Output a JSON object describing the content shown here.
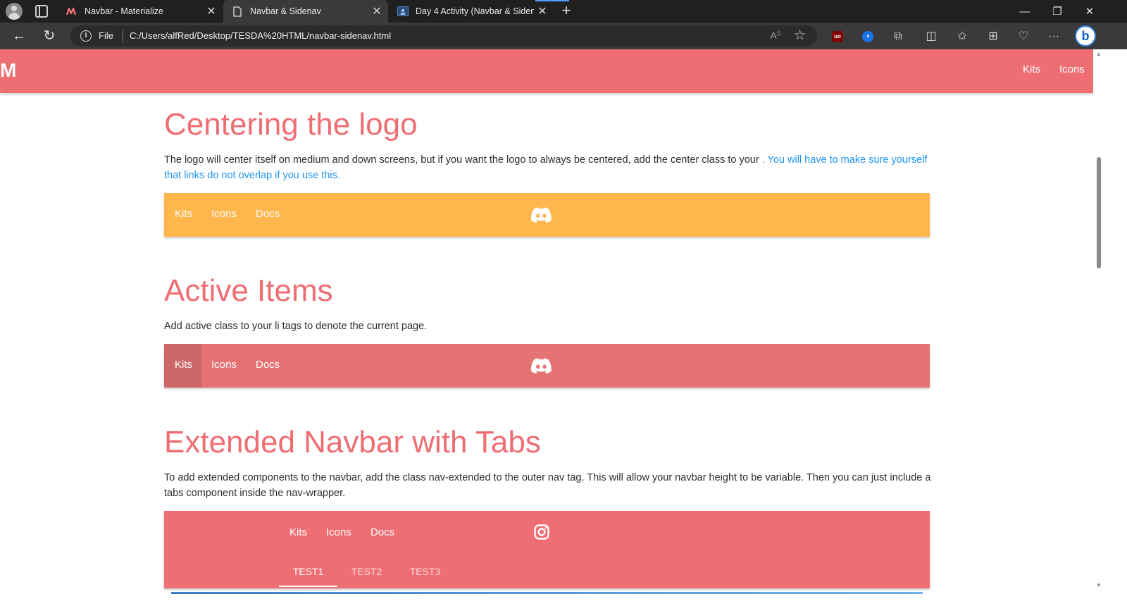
{
  "browser": {
    "tabs": [
      {
        "title": "Navbar - Materialize",
        "icon": "materialize-icon"
      },
      {
        "title": "Navbar & Sidenav",
        "icon": "page-icon"
      },
      {
        "title": "Day 4 Activity (Navbar & Sidenav",
        "icon": "classroom-icon"
      }
    ],
    "address": {
      "scheme_label": "File",
      "url": "C:/Users/alfRed/Desktop/TESDA%20HTML/navbar-sidenav.html"
    },
    "extensions": {
      "ublock_label": "uo",
      "bing_label": "b"
    }
  },
  "top_nav": {
    "logo": "M",
    "links": [
      "Kits",
      "Icons"
    ],
    "color": "#ee6e73"
  },
  "sections": [
    {
      "title": "Centering the logo",
      "text": "The logo will center itself on medium and down screens, but if you want the logo to always be centered, add the center class to your ",
      "text_highlight": ". You will have to make sure yourself that links do not overlap if you use this.",
      "demo": {
        "links": [
          "Kits",
          "Icons",
          "Docs"
        ],
        "brand_icon": "discord-icon",
        "color": "#ffb74d"
      }
    },
    {
      "title": "Active Items",
      "text": "Add active class to your li tags to denote the current page.",
      "demo": {
        "links": [
          "Kits",
          "Icons",
          "Docs"
        ],
        "active": "Kits",
        "brand_icon": "discord-icon",
        "color": "#e57373"
      }
    },
    {
      "title": "Extended Navbar with Tabs",
      "text": "To add extended components to the navbar, add the class nav-extended to the outer nav tag. This will allow your navbar height to be variable. Then you can just include a tabs component inside the nav-wrapper.",
      "demo": {
        "links": [
          "Kits",
          "Icons",
          "Docs"
        ],
        "brand_icon": "instagram-icon",
        "tabs": [
          "TEST1",
          "TEST2",
          "TEST3"
        ],
        "active_tab": "TEST1",
        "color": "#ee6e73"
      }
    }
  ]
}
